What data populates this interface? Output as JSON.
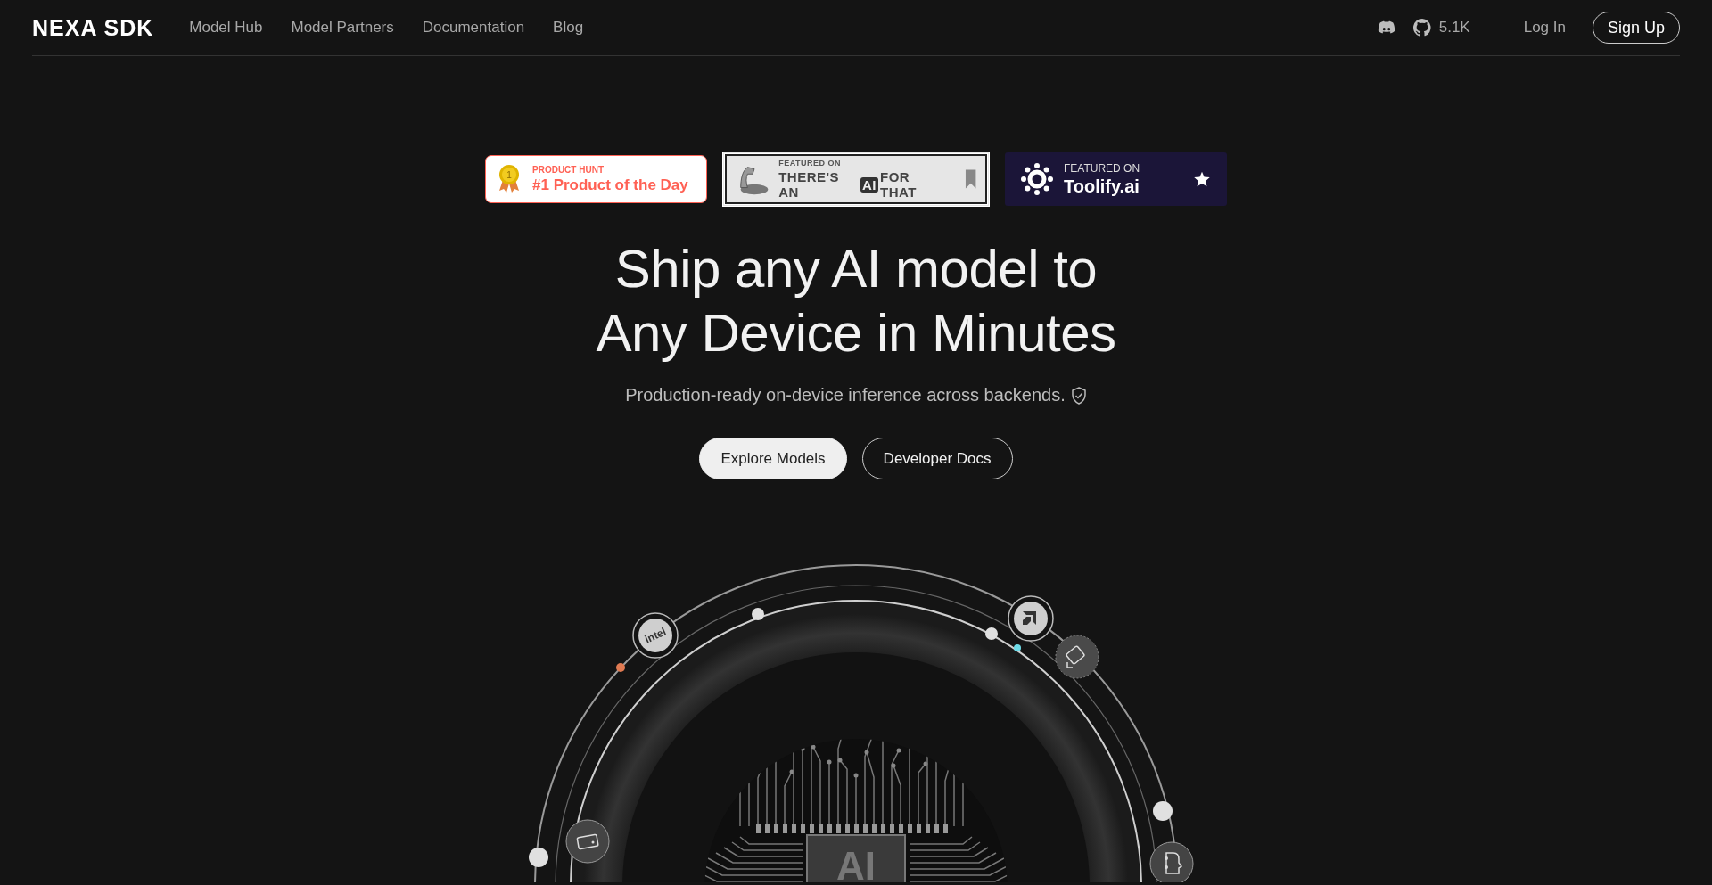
{
  "nav": {
    "logo": "NEXA SDK",
    "links": [
      {
        "label": "Model Hub"
      },
      {
        "label": "Model Partners"
      },
      {
        "label": "Documentation"
      },
      {
        "label": "Blog"
      }
    ],
    "github_stars": "5.1K",
    "login": "Log In",
    "signup": "Sign Up"
  },
  "badges": [
    {
      "kind": "producthunt",
      "medal": "1",
      "eyebrow": "PRODUCT HUNT",
      "title": "#1 Product of the Day"
    },
    {
      "kind": "taaft",
      "eyebrow": "FEATURED ON",
      "title_before": "THERE'S AN",
      "title_highlight": "AI",
      "title_after": "FOR THAT"
    },
    {
      "kind": "toolify",
      "eyebrow": "FEATURED ON",
      "title": "Toolify.ai"
    }
  ],
  "hero": {
    "title_lines": [
      "Ship any AI model to",
      "Any Device in Minutes"
    ],
    "subtitle": "Production-ready on-device inference across backends.",
    "buttons": [
      {
        "label": "Explore Models",
        "kind": "primary"
      },
      {
        "label": "Developer Docs",
        "kind": "secondary"
      }
    ]
  },
  "diagram": {
    "intel_label": "intel",
    "chip_label": "AI",
    "dots": [
      {
        "color": "#e0e0e0"
      },
      {
        "color": "#e0e0e0"
      },
      {
        "color": "#e0e0e0"
      },
      {
        "color": "#e0e0e0"
      },
      {
        "color": "#e07a52"
      },
      {
        "color": "#6fdbe8"
      }
    ]
  }
}
